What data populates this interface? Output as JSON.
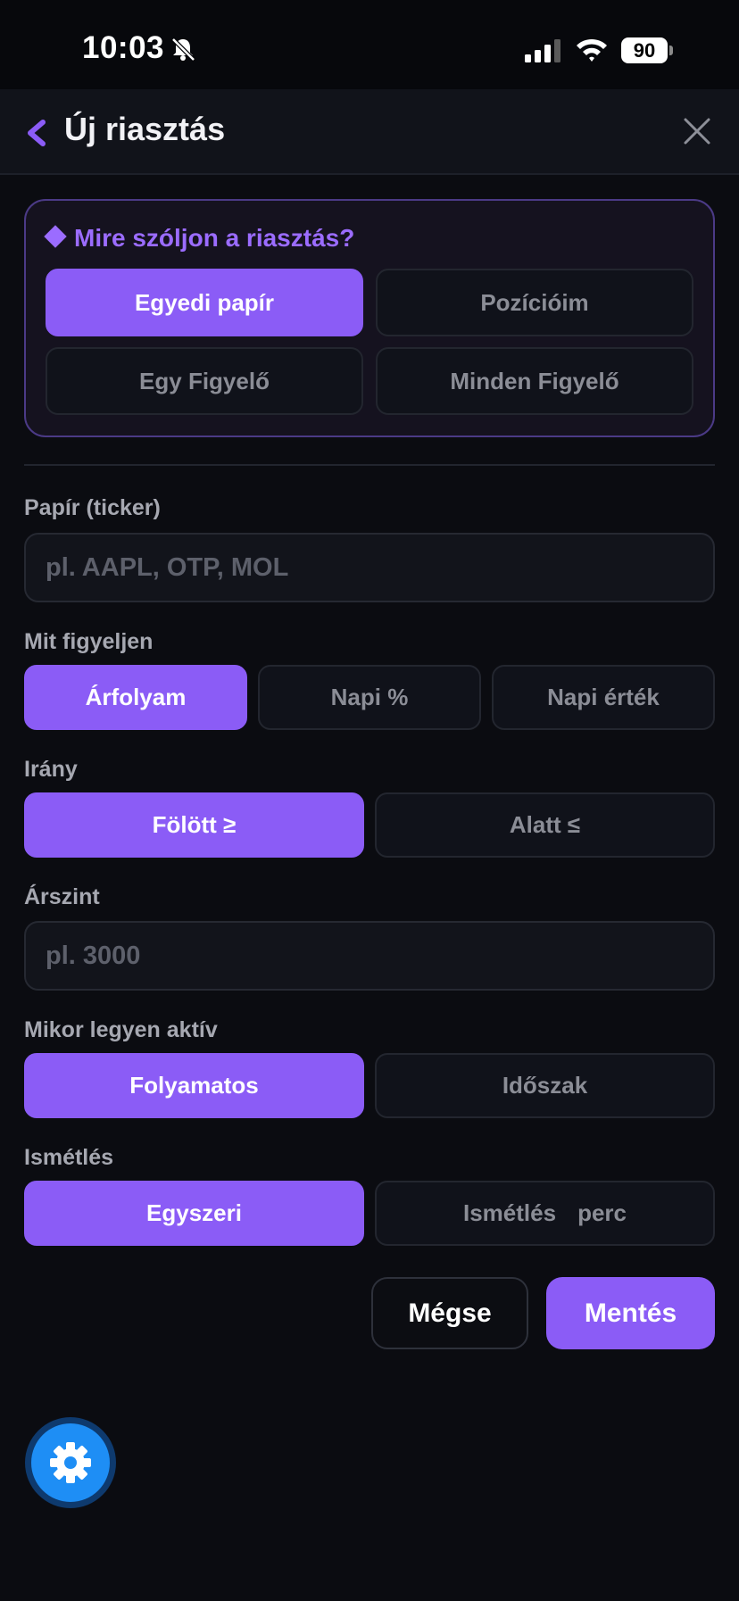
{
  "status_bar": {
    "time": "10:03",
    "battery": "90",
    "icons": [
      "bell-slash-icon",
      "signal-icon",
      "wifi-icon",
      "battery-icon"
    ]
  },
  "header": {
    "title": "Új riasztás",
    "back_icon": "chevron-left-icon",
    "close_icon": "close-icon"
  },
  "target": {
    "title": "Mire szóljon a riasztás?",
    "options": [
      "Egyedi papír",
      "Pozícióim",
      "Egy Figyelő",
      "Minden Figyelő"
    ],
    "selected": "Egyedi papír"
  },
  "ticker": {
    "label": "Papír (ticker)",
    "placeholder": "pl. AAPL, OTP, MOL",
    "value": ""
  },
  "watch": {
    "label": "Mit figyeljen",
    "options": [
      "Árfolyam",
      "Napi %",
      "Napi érték"
    ],
    "selected": "Árfolyam"
  },
  "direction": {
    "label": "Irány",
    "options": [
      "Fölött ≥",
      "Alatt ≤"
    ],
    "selected": "Fölött ≥"
  },
  "price_level": {
    "label": "Árszint",
    "placeholder": "pl. 3000",
    "value": ""
  },
  "active": {
    "label": "Mikor legyen aktív",
    "options": [
      "Folyamatos",
      "Időszak"
    ],
    "selected": "Folyamatos"
  },
  "repeat": {
    "label": "Ismétlés",
    "options": [
      "Egyszeri",
      "Ismétlés"
    ],
    "unit": "perc",
    "selected": "Egyszeri"
  },
  "actions": {
    "cancel": "Mégse",
    "save": "Mentés"
  },
  "fab": {
    "icon": "gear-icon"
  },
  "colors": {
    "accent": "#8b5cf6",
    "accent_text": "#9b6cff",
    "background": "#0b0c11",
    "fab": "#1e8ef5"
  }
}
